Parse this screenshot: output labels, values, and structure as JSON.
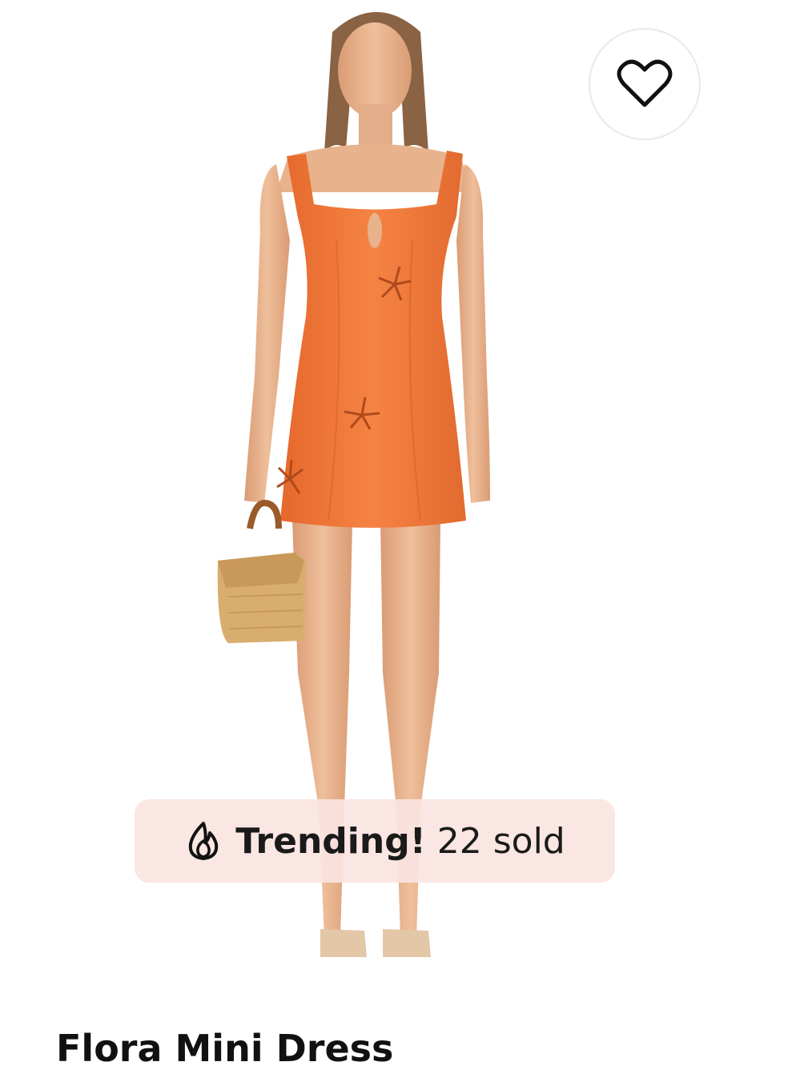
{
  "product": {
    "title": "Flora Mini Dress",
    "image_alt": "Model wearing orange mini dress with floral cutouts holding a wicker handbag"
  },
  "favorite": {
    "icon": "heart-outline-icon",
    "active": false
  },
  "badge": {
    "icon": "flame-icon",
    "highlight": "Trending!",
    "text": "22 sold",
    "background": "#fae4e0"
  },
  "colors": {
    "dress": "#f07a3a",
    "skin": "#e8b48e",
    "background": "#ffffff"
  }
}
